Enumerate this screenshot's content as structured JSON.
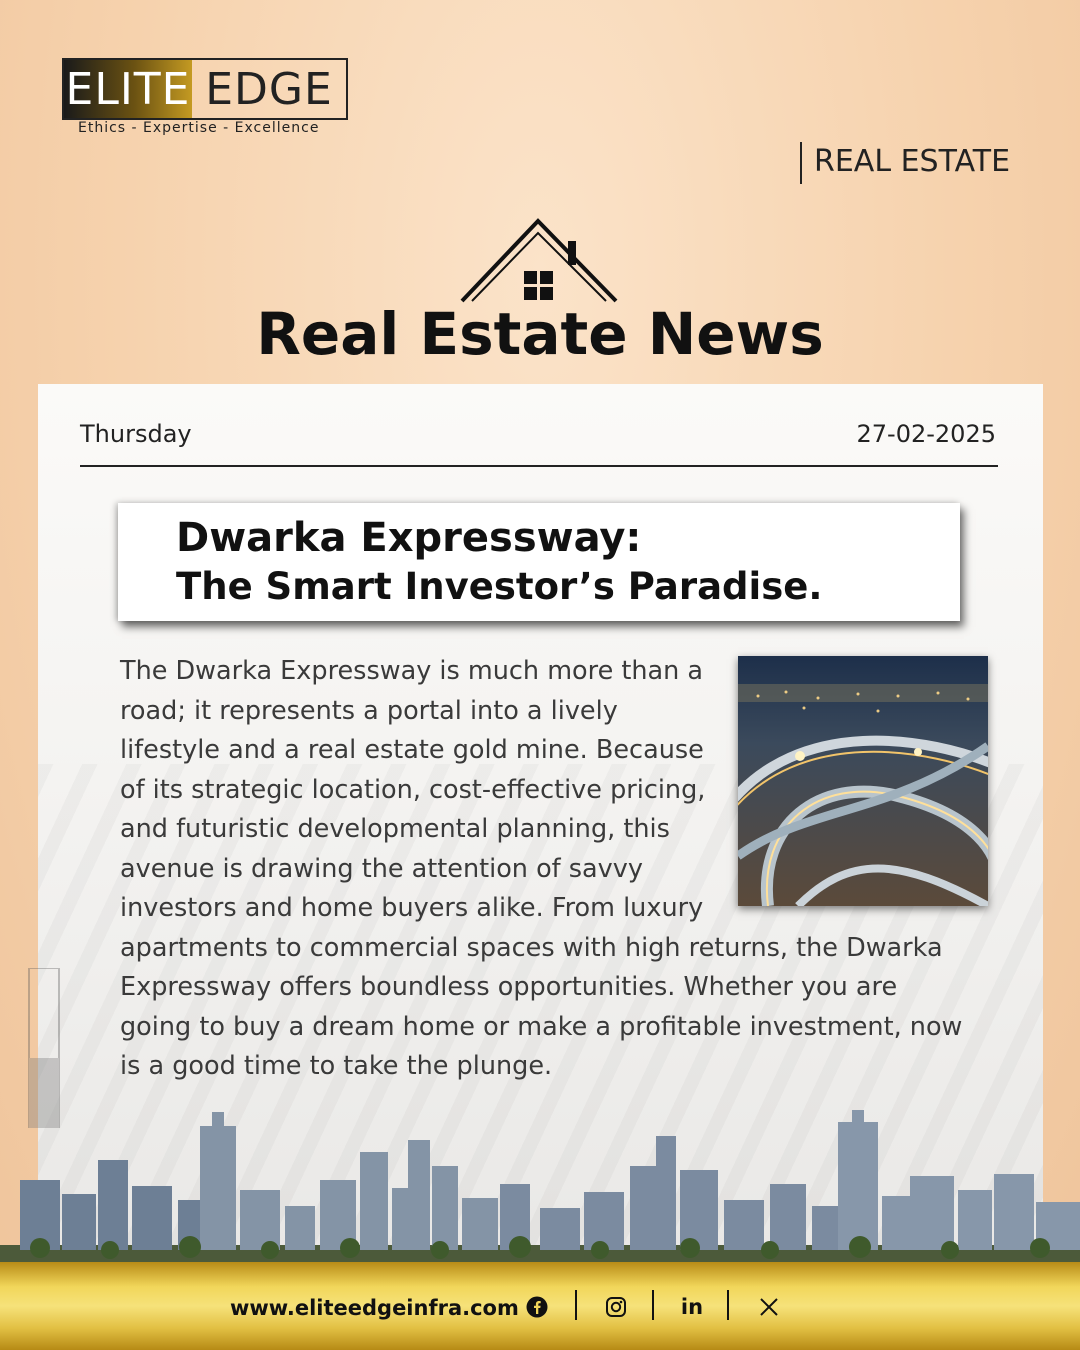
{
  "brand": {
    "logo_left": "ELITE",
    "logo_right": "EDGE",
    "tagline": "Ethics - Expertise - Excellence"
  },
  "category": "REAL ESTATE",
  "title": "Real Estate News",
  "day": "Thursday",
  "date": "27-02-2025",
  "headline": {
    "line1": "Dwarka Expressway:",
    "line2": "The Smart Investor’s Paradise."
  },
  "article": "The Dwarka Expressway is much more than a road; it represents a portal into a lively lifestyle and a real estate gold mine. Because of its strategic location, cost-effective pricing, and futuristic developmental planning, this avenue is drawing the attention of savvy investors and home buyers alike. From luxury apartments to commercial spaces with high returns, the Dwarka Expressway offers boundless opportunities. Whether you are going to buy a dream home or make a profitable investment, now is a good time to take the plunge.",
  "footer": {
    "website": "www.eliteedgeinfra.com",
    "social": [
      {
        "icon": "facebook-icon"
      },
      {
        "icon": "instagram-icon"
      },
      {
        "icon": "linkedin-icon",
        "label": "in"
      },
      {
        "icon": "x-icon"
      }
    ]
  },
  "colors": {
    "accent_gold": "#e9c84f",
    "background_peach": "#f6d2ad",
    "text_dark": "#111111"
  }
}
